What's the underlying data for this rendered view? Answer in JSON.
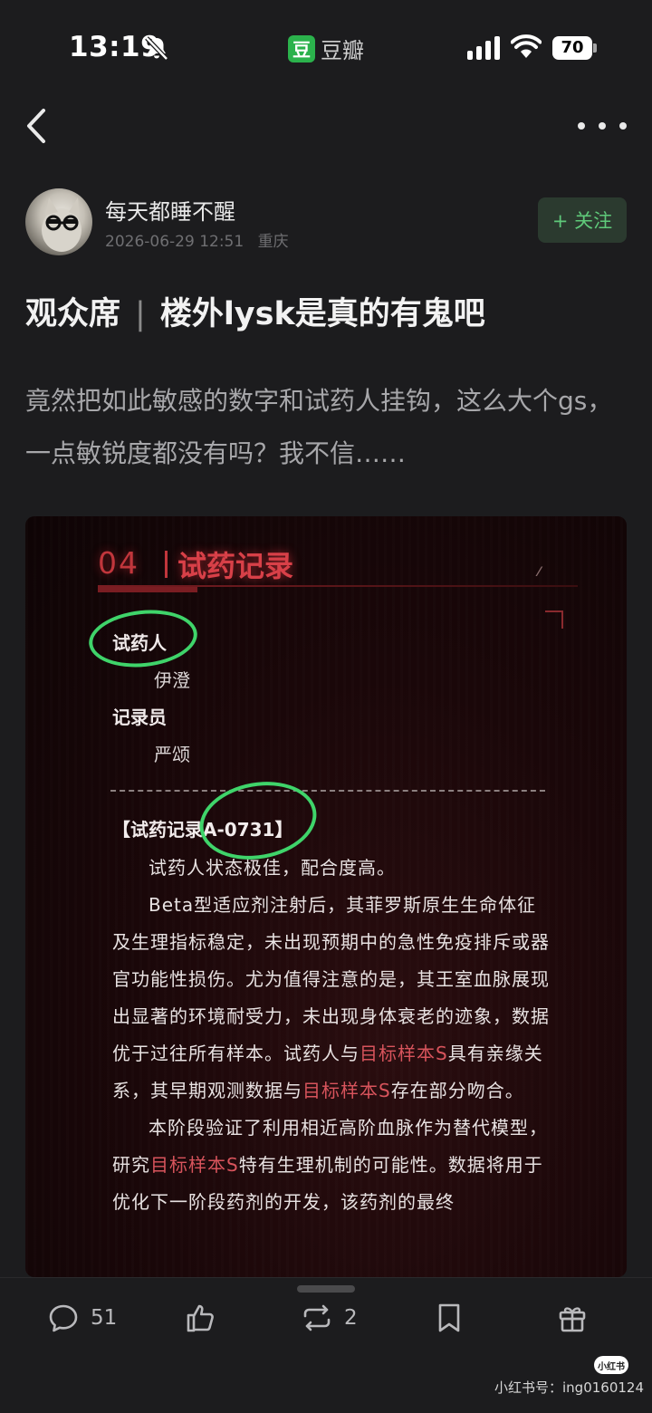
{
  "status_bar": {
    "time": "13:19",
    "app_logo": "豆",
    "app_name": "豆瓣",
    "battery": "70"
  },
  "post": {
    "author": {
      "username": "每天都睡不醒",
      "datetime": "2026-06-29 12:51",
      "location": "重庆"
    },
    "follow_label": "+ 关注",
    "title_prefix": "观众席",
    "title_separator": "|",
    "title": "楼外lysk是真的有鬼吧",
    "body": "竟然把如此敏感的数字和试药人挂钩，这么大个gs，一点敏锐度都没有吗？我不信……"
  },
  "image": {
    "section_number": "04",
    "section_title": "试药记录",
    "subject_label": "试药人",
    "subject_value": "伊澄",
    "recorder_label": "记录员",
    "recorder_value": "严颂",
    "record_head": "【试药记录A-0731】",
    "p1": "试药人状态极佳，配合度高。",
    "p2_a": "Beta型适应剂注射后，其菲罗斯原生生命体征及生理指标稳定，未出现预期中的急性免疫排斥或器官功能性损伤。尤为值得注意的是，其王室血脉展现出显著的环境耐受力，未出现身体衰老的迹象，数据优于过往所有样本。试药人与",
    "p2_hl1": "目标样本S",
    "p2_b": "具有亲缘关系，其早期观测数据与",
    "p2_hl2": "目标样本S",
    "p2_c": "存在部分吻合。",
    "p3_a": "本阶段验证了利用相近高阶血脉作为替代模型，研究",
    "p3_hl": "目标样本S",
    "p3_b": "特有生理机制的可能性。数据将用于优化下一阶段药剂的开发，该药剂的最终"
  },
  "actions": {
    "comment_count": "51",
    "repost_count": "2"
  },
  "watermark": {
    "logo": "小红书",
    "text": "小红书号：ing0160124"
  },
  "icons": [
    "bell-off-icon",
    "signal-icon",
    "wifi-icon",
    "back-icon",
    "more-icon",
    "comment-icon",
    "like-icon",
    "repost-icon",
    "bookmark-icon",
    "gift-icon"
  ],
  "colors": {
    "accent_green": "#2bb24c",
    "highlight_red": "#d8545c",
    "background": "#1c1c1e"
  }
}
